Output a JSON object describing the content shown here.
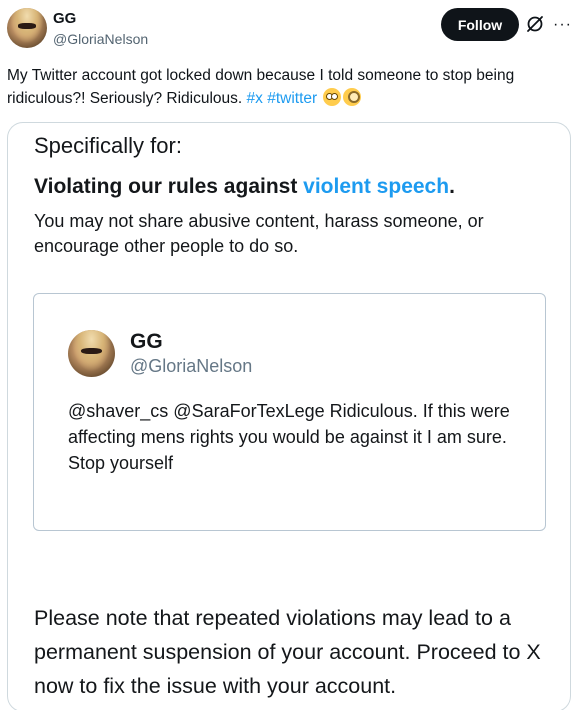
{
  "post": {
    "author_name": "GG",
    "author_handle": "@GloriaNelson",
    "follow_label": "Follow",
    "text_main": "My Twitter account got locked down because I told someone to stop being ridiculous?!  Seriously? Ridiculous. ",
    "hashtag_1": "#x",
    "hashtag_2": "#twitter",
    "emojis": [
      "flushed-face-emoji",
      "face-with-monocle-emoji"
    ]
  },
  "media": {
    "specifically_label": "Specifically for:",
    "violation_prefix": "Violating our rules against ",
    "violation_link": "violent speech",
    "violation_suffix": ".",
    "violation_description": "You may not share abusive content, harass someone, or encourage other people to do so.",
    "quoted": {
      "name": "GG",
      "handle": "@GloriaNelson",
      "text": "@shaver_cs @SaraForTexLege Ridiculous. If this were affecting mens rights you would be against it I am sure. Stop yourself"
    },
    "notice": "Please note that repeated violations may lead to a permanent suspension of your account. Proceed to X now to fix the issue with your account."
  },
  "icons": {
    "grok": "grok-icon",
    "more": "more-icon"
  },
  "colors": {
    "accent": "#1d9bf0",
    "follow_bg": "#0f1419",
    "secondary_text": "#536471"
  }
}
